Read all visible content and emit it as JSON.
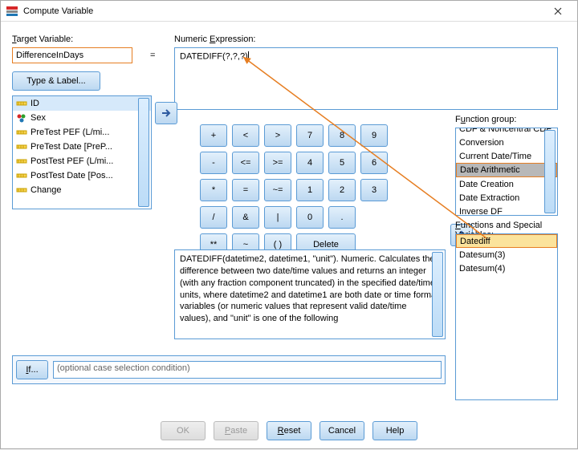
{
  "window": {
    "title": "Compute Variable"
  },
  "target": {
    "label": "Target Variable:",
    "value": "DifferenceInDays",
    "typeButton": "Type & Label..."
  },
  "eq": "=",
  "expression": {
    "label": "Numeric Expression:",
    "value": "DATEDIFF(?,?,?)"
  },
  "variables": [
    {
      "icon": "ruler",
      "label": "ID",
      "sel": true
    },
    {
      "icon": "nominal",
      "label": "Sex",
      "sel": false
    },
    {
      "icon": "ruler",
      "label": "PreTest PEF (L/mi...",
      "sel": false
    },
    {
      "icon": "ruler",
      "label": "PreTest Date [PreP...",
      "sel": false
    },
    {
      "icon": "ruler",
      "label": "PostTest PEF (L/mi...",
      "sel": false
    },
    {
      "icon": "ruler",
      "label": "PostTest Date [Pos...",
      "sel": false
    },
    {
      "icon": "ruler",
      "label": "Change",
      "sel": false
    }
  ],
  "keypad": [
    [
      "+",
      "<",
      ">",
      "7",
      "8",
      "9"
    ],
    [
      "-",
      "<=",
      ">=",
      "4",
      "5",
      "6"
    ],
    [
      "*",
      "=",
      "~=",
      "1",
      "2",
      "3"
    ],
    [
      "/",
      "&",
      "|",
      "0",
      ".",
      " "
    ],
    [
      "**",
      "~",
      "( )",
      "Delete"
    ]
  ],
  "funcGroup": {
    "label": "Function group:",
    "items": [
      "CDF & Noncentral CDF",
      "Conversion",
      "Current Date/Time",
      "Date Arithmetic",
      "Date Creation",
      "Date Extraction",
      "Inverse DF"
    ],
    "selected": 3
  },
  "functions": {
    "label": "Functions and Special Variables:",
    "items": [
      "Datediff",
      "Datesum(3)",
      "Datesum(4)"
    ],
    "selected": 0
  },
  "description": "DATEDIFF(datetime2, datetime1, \"unit\"). Numeric. Calculates the difference between two date/time values and returns an integer (with any fraction component truncated) in the specified date/time units, where datetime2 and datetime1 are both date or time format variables (or numeric values that represent valid date/time values), and \"unit\" is one of the following",
  "ifRow": {
    "button": "If...",
    "text": "(optional case selection condition)",
    "value": ""
  },
  "buttons": {
    "ok": "OK",
    "paste": "Paste",
    "reset": "Reset",
    "cancel": "Cancel",
    "help": "Help"
  }
}
